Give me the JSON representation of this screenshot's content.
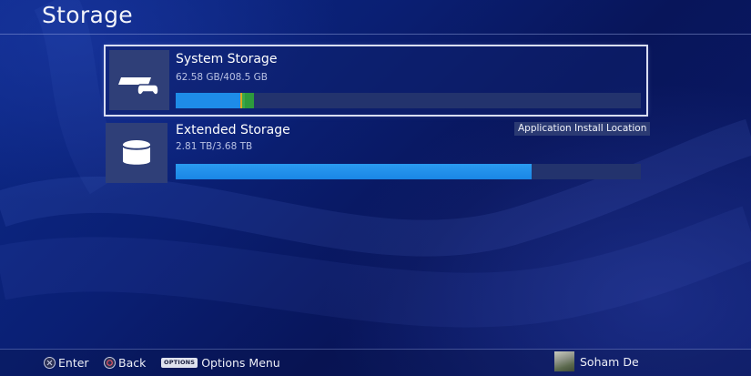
{
  "header": {
    "title": "Storage"
  },
  "storage": {
    "items": [
      {
        "name": "System Storage",
        "usage": "62.58 GB/408.5 GB",
        "icon": "console-controller-icon",
        "selected": true,
        "used_fraction": 0.153,
        "segments": [
          {
            "fraction": 0.138,
            "color": "#1e8ce8"
          },
          {
            "fraction": 0.005,
            "color": "#e0a81a"
          },
          {
            "fraction": 0.005,
            "color": "#3aa84a"
          },
          {
            "fraction": 0.02,
            "color": "#2d9a3c"
          }
        ]
      },
      {
        "name": "Extended Storage",
        "usage": "2.81 TB/3.68 TB",
        "icon": "external-drive-icon",
        "selected": false,
        "badge": "Application Install Location",
        "used_fraction": 0.765
      }
    ]
  },
  "footer": {
    "hints": [
      {
        "button": "cross-button-icon",
        "label": "Enter"
      },
      {
        "button": "circle-button-icon",
        "label": "Back"
      },
      {
        "button": "options-button-icon",
        "button_text": "OPTIONS",
        "label": "Options Menu"
      }
    ],
    "user": {
      "name": "Soham De"
    }
  },
  "colors": {
    "bar_fill": "#1e8ce8",
    "bar_track": "#23336d",
    "tile": "#2f3f78",
    "selection_border": "#d9def3"
  }
}
